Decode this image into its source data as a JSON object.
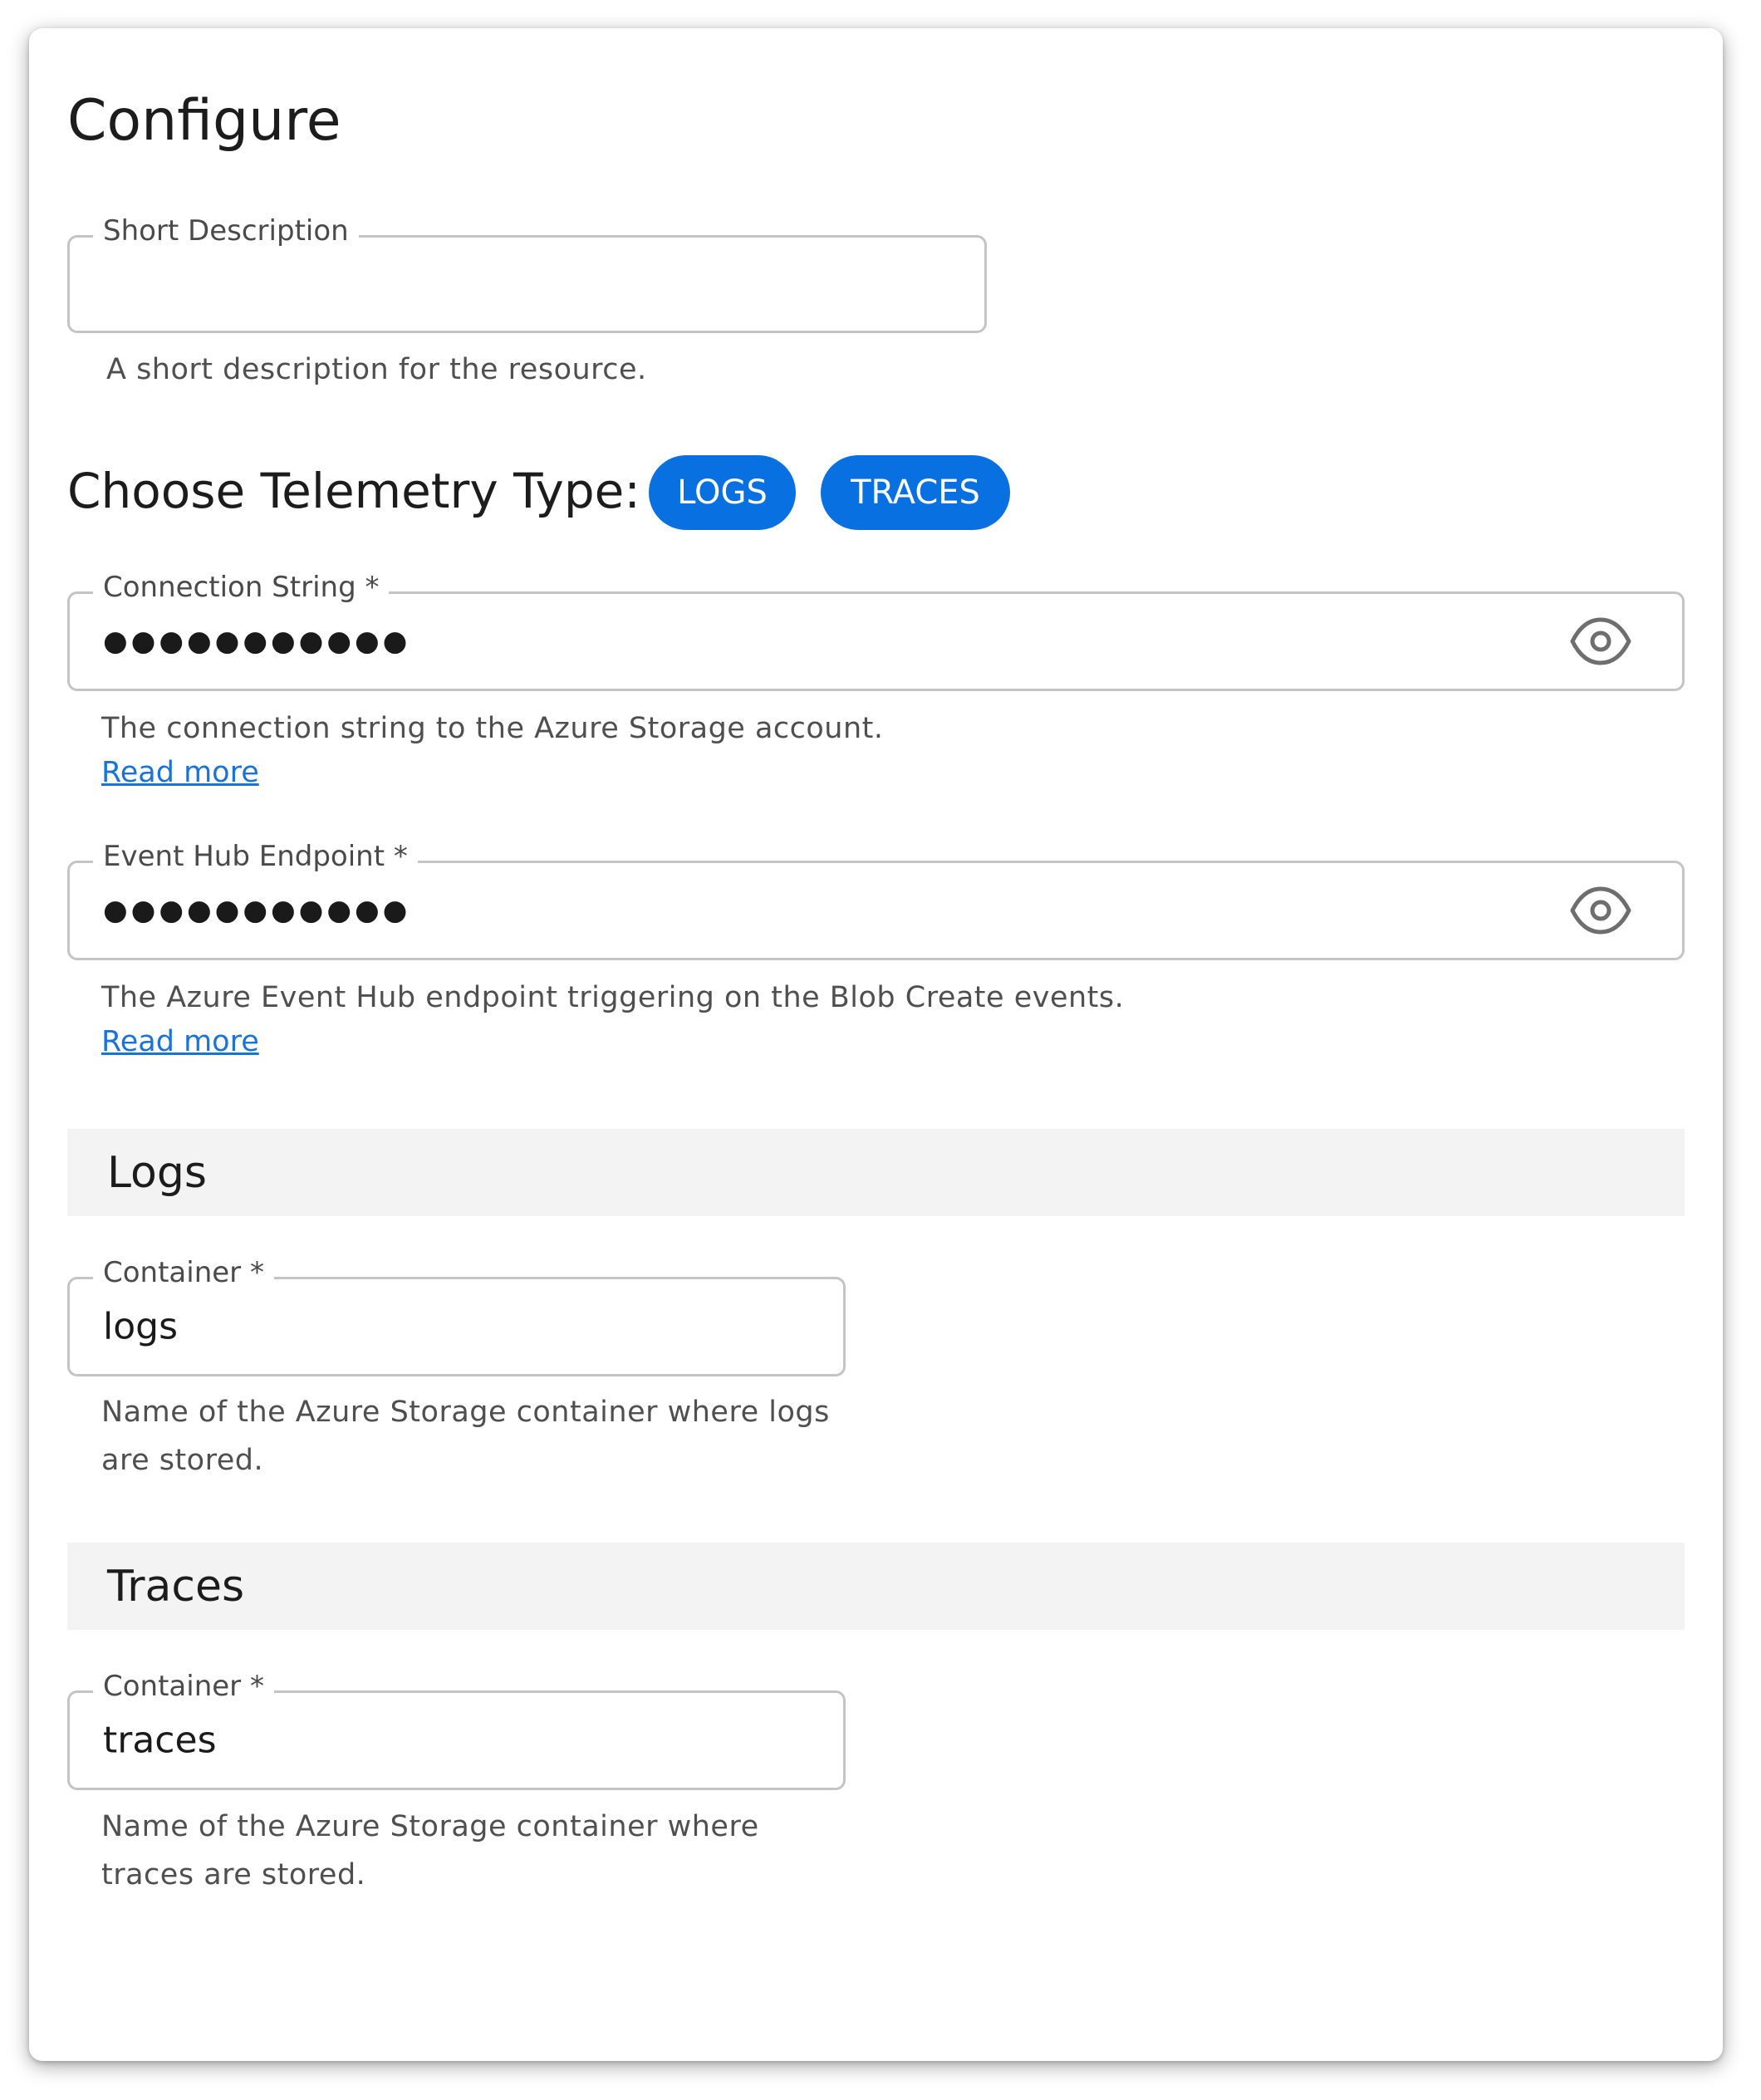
{
  "page": {
    "title": "Configure"
  },
  "short_description": {
    "label": "Short Description",
    "value": "",
    "helper": "A short description for the resource."
  },
  "telemetry": {
    "heading": "Choose Telemetry Type:",
    "chips": [
      "LOGS",
      "TRACES"
    ],
    "chip_color": "#0870e0"
  },
  "connection_string": {
    "label": "Connection String *",
    "masked_value": "●●●●●●●●●●●",
    "icon": "eye-icon",
    "helper": "The connection string to the Azure Storage account.",
    "link": "Read more"
  },
  "event_hub_endpoint": {
    "label": "Event Hub Endpoint *",
    "masked_value": "●●●●●●●●●●●",
    "icon": "eye-icon",
    "helper": "The Azure Event Hub endpoint triggering on the Blob Create events.",
    "link": "Read more"
  },
  "logs_section": {
    "title": "Logs",
    "container_label": "Container *",
    "container_value": "logs",
    "helper": "Name of the Azure Storage container where logs are stored."
  },
  "traces_section": {
    "title": "Traces",
    "container_label": "Container *",
    "container_value": "traces",
    "helper": "Name of the Azure Storage container where traces are stored."
  },
  "colors": {
    "accent": "#0870e0",
    "link": "#1a73d6",
    "section_bg": "#f3f3f3",
    "border": "#c4c4c4"
  }
}
